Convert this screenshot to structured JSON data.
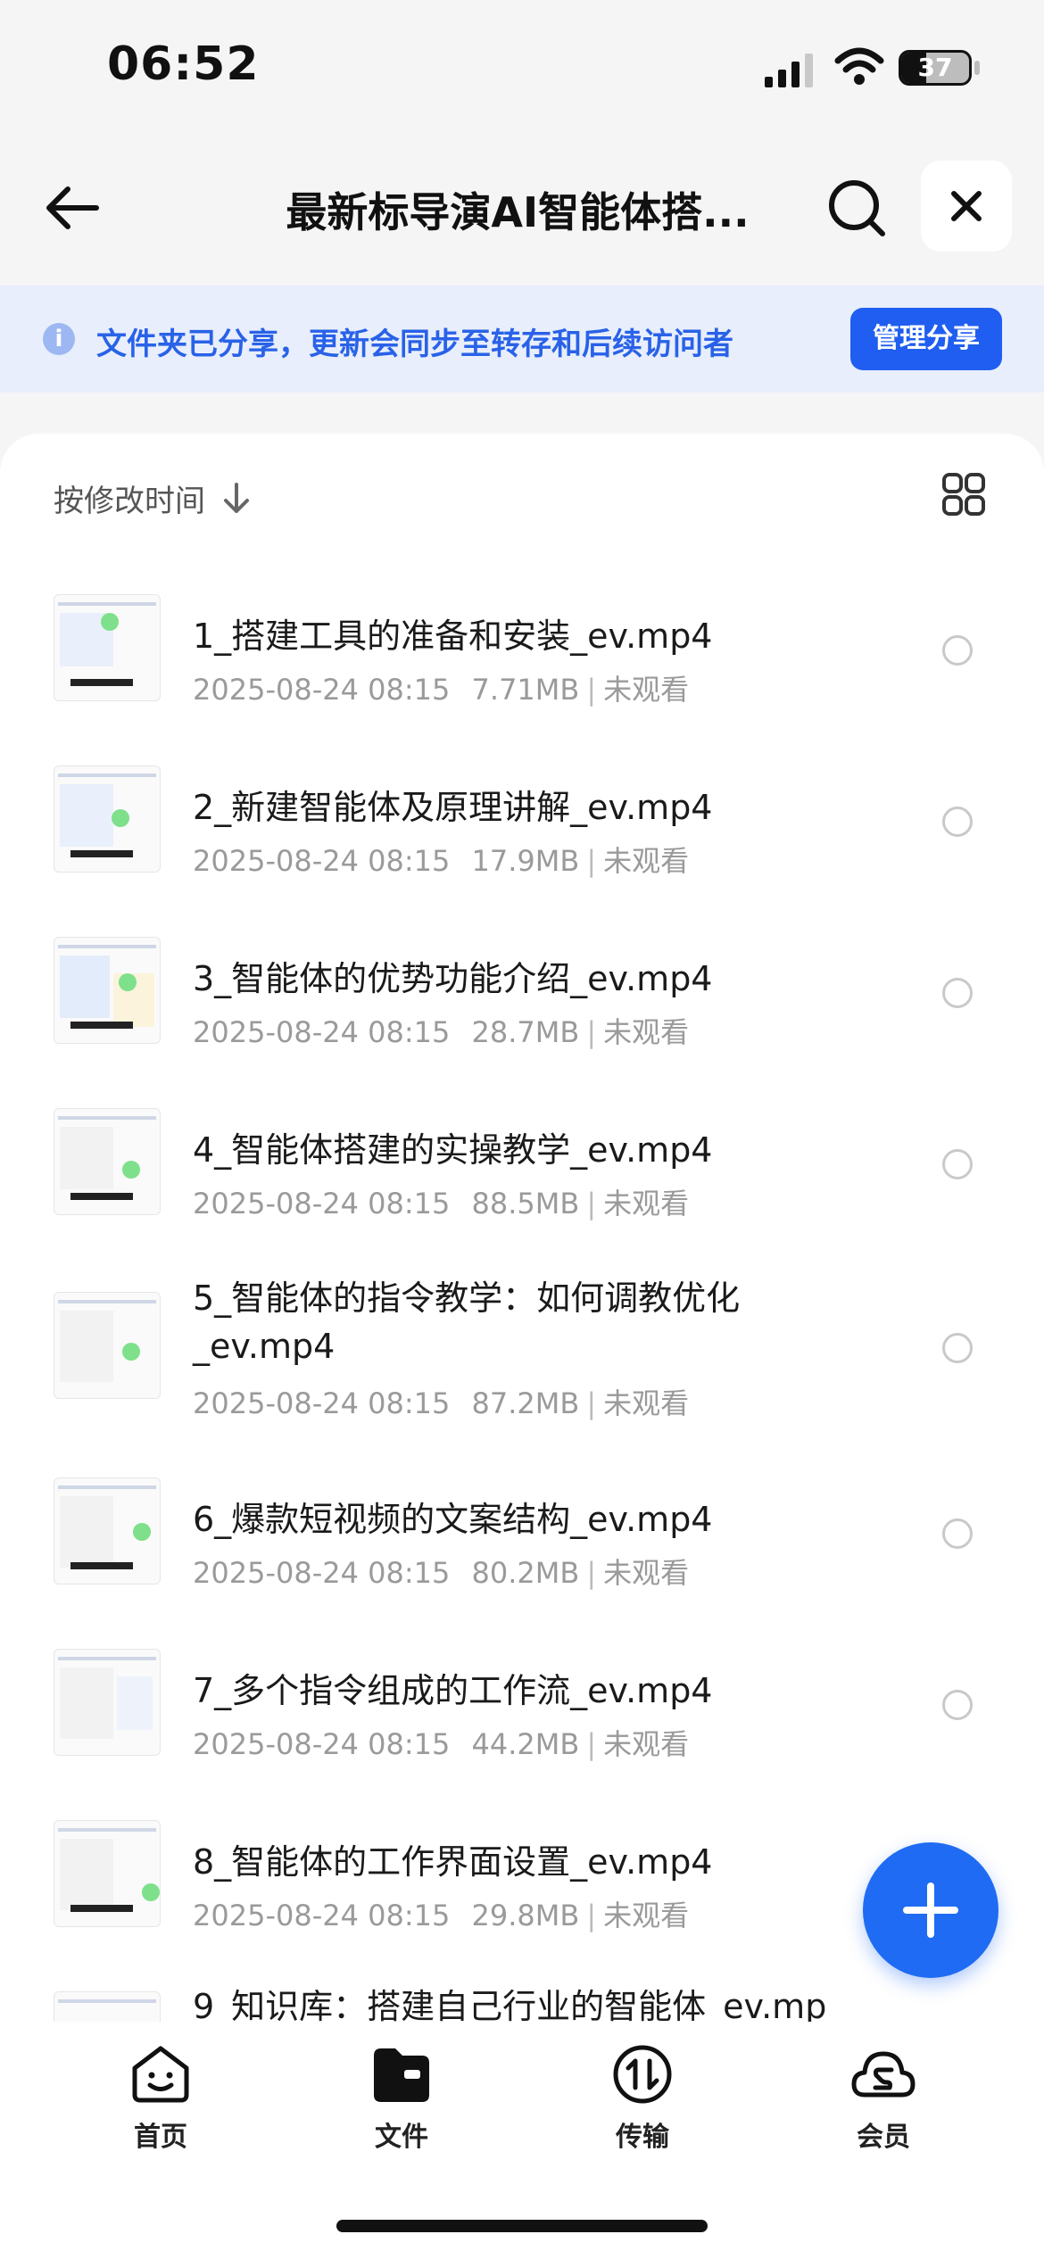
{
  "status": {
    "time": "06:52",
    "battery": "37"
  },
  "header": {
    "title": "最新标导演AI智能体搭..."
  },
  "banner": {
    "text": "文件夹已分享，更新会同步至转存和后续访问者",
    "button": "管理分享"
  },
  "sort": {
    "label": "按修改时间"
  },
  "files": [
    {
      "name": "1_搭建工具的准备和安装_ev.mp4",
      "date": "2025-08-24 08:15",
      "size": "7.71MB",
      "status": "未观看"
    },
    {
      "name": "2_新建智能体及原理讲解_ev.mp4",
      "date": "2025-08-24 08:15",
      "size": "17.9MB",
      "status": "未观看"
    },
    {
      "name": "3_智能体的优势功能介绍_ev.mp4",
      "date": "2025-08-24 08:15",
      "size": "28.7MB",
      "status": "未观看"
    },
    {
      "name": "4_智能体搭建的实操教学_ev.mp4",
      "date": "2025-08-24 08:15",
      "size": "88.5MB",
      "status": "未观看"
    },
    {
      "name": "5_智能体的指令教学：如何调教优化_ev.mp4",
      "date": "2025-08-24 08:15",
      "size": "87.2MB",
      "status": "未观看"
    },
    {
      "name": "6_爆款短视频的文案结构_ev.mp4",
      "date": "2025-08-24 08:15",
      "size": "80.2MB",
      "status": "未观看"
    },
    {
      "name": "7_多个指令组成的工作流_ev.mp4",
      "date": "2025-08-24 08:15",
      "size": "44.2MB",
      "status": "未观看"
    },
    {
      "name": "8_智能体的工作界面设置_ev.mp4",
      "date": "2025-08-24 08:15",
      "size": "29.8MB",
      "status": "未观看"
    },
    {
      "name": "9_知识库：搭建自己行业的智能体_ev.mp",
      "date": "",
      "size": "",
      "status": ""
    }
  ],
  "tabs": [
    {
      "label": "首页",
      "icon": "home-face-icon"
    },
    {
      "label": "文件",
      "icon": "folder-icon"
    },
    {
      "label": "传输",
      "icon": "transfer-icon"
    },
    {
      "label": "会员",
      "icon": "vip-cloud-icon"
    }
  ],
  "colors": {
    "accent": "#1f5ef0",
    "banner_bg": "#e8eefb",
    "banner_text": "#2962e8"
  }
}
